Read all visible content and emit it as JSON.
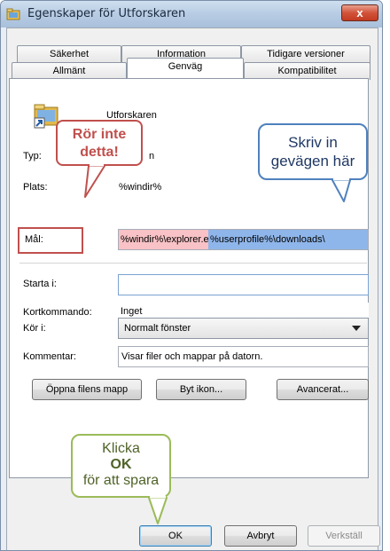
{
  "window": {
    "title": "Egenskaper för Utforskaren",
    "close_label": "x"
  },
  "tabs": {
    "row1": [
      "Säkerhet",
      "Information",
      "Tidigare versioner"
    ],
    "row2": [
      "Allmänt",
      "Genväg",
      "Kompatibilitet"
    ],
    "active": "Genväg"
  },
  "shortcut": {
    "app_name": "Utforskaren",
    "type_label": "Typ:",
    "type_value": "n",
    "location_label": "Plats:",
    "location_value": "%windir%",
    "target_label": "Mål:",
    "target_part1": "%windir%\\explorer.exe",
    "target_part2": "%userprofile%\\downloads\\",
    "start_in_label": "Starta i:",
    "start_in_value": "",
    "shortcut_key_label": "Kortkommando:",
    "shortcut_key_value": "Inget",
    "run_label": "Kör i:",
    "run_value": "Normalt fönster",
    "comment_label": "Kommentar:",
    "comment_value": "Visar filer och mappar på datorn."
  },
  "panel_buttons": {
    "open_location": "Öppna filens mapp",
    "change_icon": "Byt ikon...",
    "advanced": "Avancerat..."
  },
  "dialog_buttons": {
    "ok": "OK",
    "cancel": "Avbryt",
    "apply": "Verkställ"
  },
  "annotations": {
    "red_line1": "Rör inte",
    "red_line2": "detta!",
    "blue_line1": "Skriv in",
    "blue_line2": "gevägen här",
    "green_line1": "Klicka",
    "green_line2": "OK",
    "green_line3": "för att spara"
  },
  "colors": {
    "red": "#c0504d",
    "blue": "#4f81bd",
    "green": "#9bbb59",
    "target_part1_bg": "#f8c2c6",
    "target_part2_bg": "#8fb6ea"
  },
  "icons": {
    "title": "folder-icon",
    "app": "explorer-shortcut-icon",
    "close": "close-icon",
    "dropdown": "chevron-down-icon"
  }
}
